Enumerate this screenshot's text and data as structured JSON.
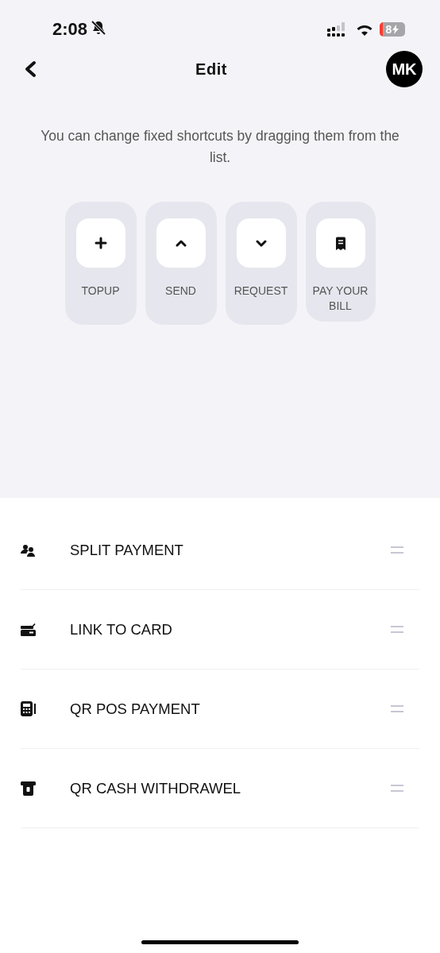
{
  "status_bar": {
    "time": "2:08",
    "silent": true,
    "battery_text": "8"
  },
  "header": {
    "title": "Edit",
    "avatar": "MK"
  },
  "hint": "You can change fixed shortcuts by dragging them from the list.",
  "shortcuts": [
    {
      "kind": "plus",
      "label": "TOPUP"
    },
    {
      "kind": "up",
      "label": "SEND"
    },
    {
      "kind": "down",
      "label": "REQUEST"
    },
    {
      "kind": "receipt",
      "label": "PAY YOUR BILL"
    }
  ],
  "list": [
    {
      "kind": "people",
      "label": "SPLIT PAYMENT"
    },
    {
      "kind": "card",
      "label": "LINK TO CARD"
    },
    {
      "kind": "pos",
      "label": "QR POS PAYMENT"
    },
    {
      "kind": "atm",
      "label": "QR CASH WITHDRAWEL"
    }
  ]
}
